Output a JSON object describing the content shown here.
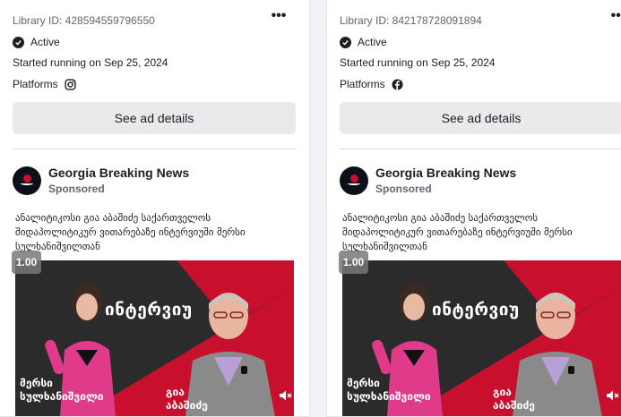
{
  "cards": [
    {
      "library_id": "Library ID: 428594559796550",
      "more_label": "•••",
      "status": "Active",
      "started": "Started running on Sep 25, 2024",
      "platforms_label": "Platforms",
      "platform_icon": "instagram-icon",
      "details_button": "See ad details",
      "advertiser_name": "Georgia Breaking News",
      "sponsored": "Sponsored",
      "ad_text_line1": "ანალიტიკოსი გია აბაშიძე საქართველოს",
      "ad_text_line2": "შიდაპოლიტიკურ ვითარებაზე ინტერვიუში მერსი",
      "ad_text_line3": "სულხანიშვილთან",
      "rate": "1.00",
      "media_title": "ინტერვიუ",
      "media_name_left_1": "მერსი",
      "media_name_left_2": "სულხანიშვილი",
      "media_name_right_1": "გია",
      "media_name_right_2": "აბაშიძე"
    },
    {
      "library_id": "Library ID: 842178728091894",
      "more_label": "•••",
      "status": "Active",
      "started": "Started running on Sep 25, 2024",
      "platforms_label": "Platforms",
      "platform_icon": "facebook-icon",
      "details_button": "See ad details",
      "advertiser_name": "Georgia Breaking News",
      "sponsored": "Sponsored",
      "ad_text_line1": "ანალიტიკოსი გია აბაშიძე საქართველოს",
      "ad_text_line2": "შიდაპოლიტიკურ ვითარებაზე ინტერვიუში მერსი",
      "ad_text_line3": "სულხანიშვილთან",
      "rate": "1.00",
      "media_title": "ინტერვიუ",
      "media_name_left_1": "მერსი",
      "media_name_left_2": "სულხანიშვილი",
      "media_name_right_1": "გია",
      "media_name_right_2": "აბაშიძე"
    }
  ],
  "colors": {
    "accent_red": "#c8102e",
    "dark_bg": "#2b2b2b",
    "button_bg": "#e9eaec"
  }
}
